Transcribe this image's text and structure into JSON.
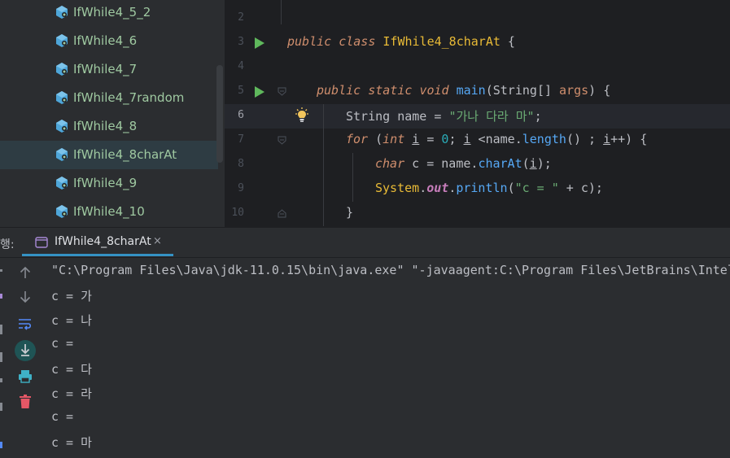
{
  "project_tree": {
    "items": [
      {
        "label": "IfWhile4_5_2"
      },
      {
        "label": "IfWhile4_6"
      },
      {
        "label": "IfWhile4_7"
      },
      {
        "label": "IfWhile4_7random"
      },
      {
        "label": "IfWhile4_8"
      },
      {
        "label": "IfWhile4_8charAt",
        "selected": true
      },
      {
        "label": "IfWhile4_9"
      },
      {
        "label": "IfWhile4_10"
      }
    ]
  },
  "editor": {
    "lines": [
      {
        "number": "2"
      },
      {
        "number": "3",
        "kw1": "public",
        "kw2": "class",
        "name": "IfWhile4_8charAt",
        "rest": " {"
      },
      {
        "number": "4"
      },
      {
        "number": "5",
        "kw1": "public",
        "kw2": "static",
        "kw3": "void",
        "fn": "main",
        "p1": "(",
        "type": "String",
        "p2": "[] ",
        "param": "args",
        "p3": ") {"
      },
      {
        "number": "6",
        "type": "String",
        "mid": " name = ",
        "str": "\"가나 다라 마\"",
        "end": ";"
      },
      {
        "number": "7",
        "kw": "for",
        "a": " (",
        "ty": "int",
        "b": " ",
        "v1": "i",
        "c": " = ",
        "n0": "0",
        "d": "; ",
        "v2": "i",
        "e": " <name.",
        "fn": "length",
        "f": "() ; ",
        "v3": "i",
        "g": "++) {"
      },
      {
        "number": "8",
        "ty": "char",
        "a": " c = name.",
        "fn": "charAt",
        "b": "(",
        "v": "i",
        "c": ");"
      },
      {
        "number": "9",
        "cls": "System",
        "dot": ".",
        "field": "out",
        "dot2": ".",
        "fn": "println",
        "a": "(",
        "str": "\"c = \"",
        "b": " + c);"
      },
      {
        "number": "10",
        "text": "}"
      }
    ]
  },
  "run_panel": {
    "title": "행:",
    "tab_label": "IfWhile4_8charAt",
    "tab_close": "×",
    "console_lines": [
      "\"C:\\Program Files\\Java\\jdk-11.0.15\\bin\\java.exe\" \"-javaagent:C:\\Program Files\\JetBrains\\Intel",
      "c = 가",
      "c = 나",
      "c =  ",
      "c = 다",
      "c = 라",
      "c =  ",
      "c = 마"
    ]
  },
  "colors": {
    "editor_bg": "#1e1f22",
    "panel_bg": "#2b2d30",
    "tab_underline": "#3592c4",
    "run_green": "#5fb85c",
    "tree_label": "#9fc9a1"
  },
  "icons": {
    "tree": "java-class-file-icon",
    "run": "run-gutter-icon",
    "bulb": "intention-bulb-icon",
    "up": "arrow-up-icon",
    "down": "arrow-down-icon",
    "wrap": "soft-wrap-icon",
    "scroll": "scroll-to-end-icon",
    "print": "print-icon",
    "trash": "trash-icon"
  }
}
